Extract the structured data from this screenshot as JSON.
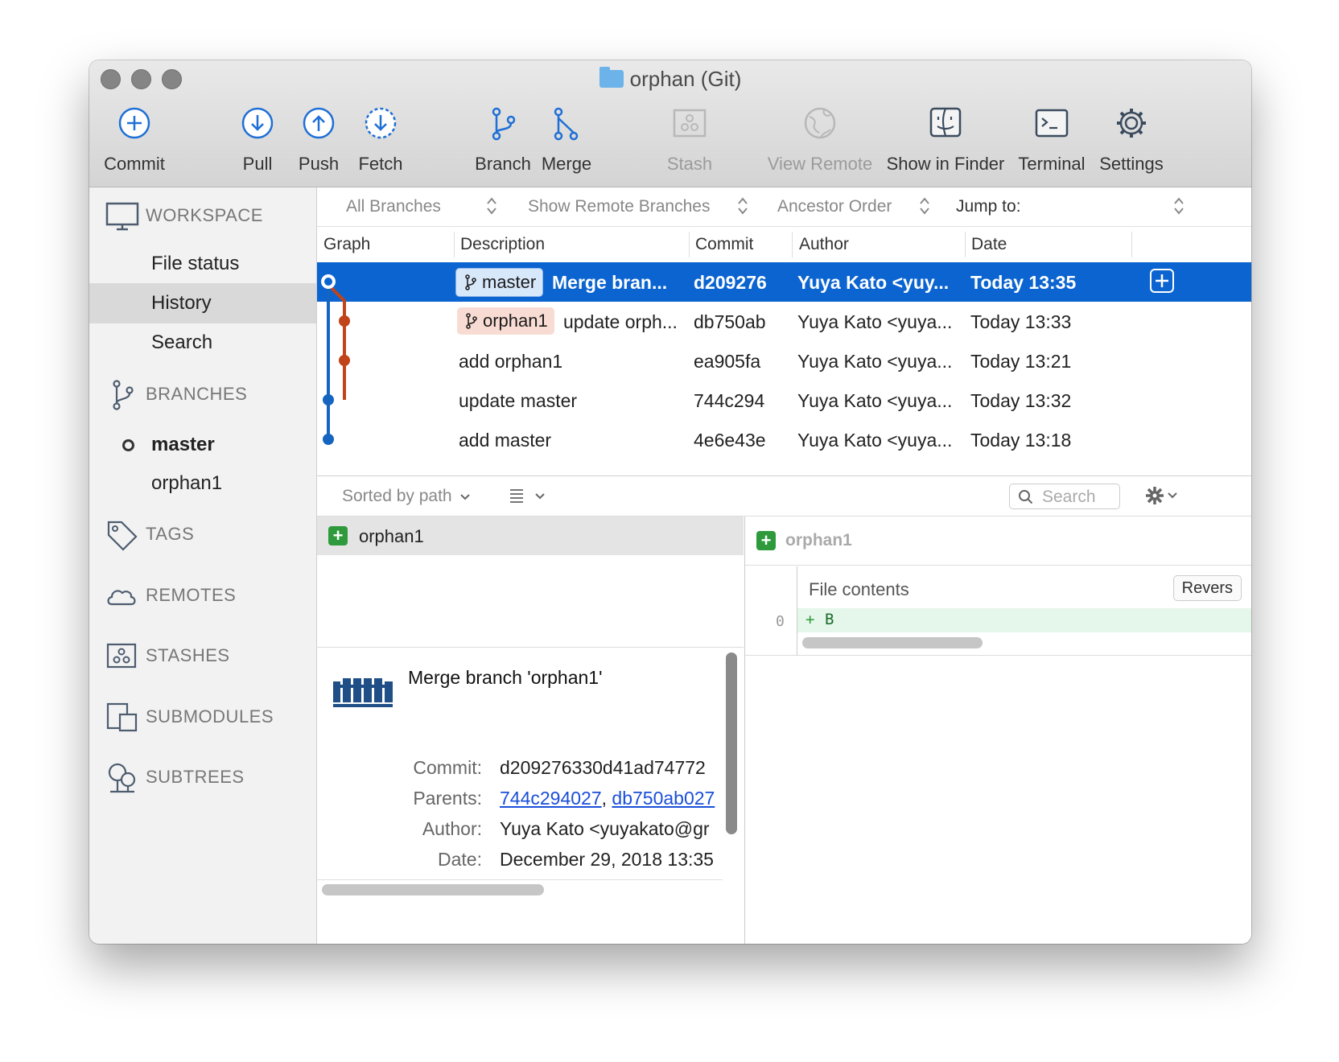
{
  "window": {
    "title": "orphan (Git)"
  },
  "toolbar": {
    "commit": "Commit",
    "pull": "Pull",
    "push": "Push",
    "fetch": "Fetch",
    "branch": "Branch",
    "merge": "Merge",
    "stash": "Stash",
    "view_remote": "View Remote",
    "show_in_finder": "Show in Finder",
    "terminal": "Terminal",
    "settings": "Settings"
  },
  "sidebar": {
    "workspace": "WORKSPACE",
    "workspace_items": [
      "File status",
      "History",
      "Search"
    ],
    "branches": "BRANCHES",
    "branch_items": [
      "master",
      "orphan1"
    ],
    "tags": "TAGS",
    "remotes": "REMOTES",
    "stashes": "STASHES",
    "submodules": "SUBMODULES",
    "subtrees": "SUBTREES"
  },
  "filters": {
    "branches": "All Branches",
    "remote": "Show Remote Branches",
    "order": "Ancestor Order",
    "jump": "Jump to:"
  },
  "columns": {
    "graph": "Graph",
    "description": "Description",
    "commit": "Commit",
    "author": "Author",
    "date": "Date"
  },
  "commits": [
    {
      "tag": "master",
      "description": "Merge bran...",
      "commit": "d209276",
      "author": "Yuya Kato <yuy...",
      "date": "Today 13:35"
    },
    {
      "tag": "orphan1",
      "description": "update orph...",
      "commit": "db750ab",
      "author": "Yuya Kato <yuya...",
      "date": "Today 13:33"
    },
    {
      "tag": "",
      "description": "add orphan1",
      "commit": "ea905fa",
      "author": "Yuya Kato <yuya...",
      "date": "Today 13:21"
    },
    {
      "tag": "",
      "description": "update master",
      "commit": "744c294",
      "author": "Yuya Kato <yuya...",
      "date": "Today 13:32"
    },
    {
      "tag": "",
      "description": "add master",
      "commit": "4e6e43e",
      "author": "Yuya Kato <yuya...",
      "date": "Today 13:18"
    }
  ],
  "file_bar": {
    "sort": "Sorted by path",
    "search_placeholder": "Search"
  },
  "files": [
    {
      "name": "orphan1",
      "status": "added"
    }
  ],
  "commit_detail": {
    "message": "Merge branch 'orphan1'",
    "commit_label": "Commit:",
    "commit_value": "d209276330d41ad74772",
    "parents_label": "Parents:",
    "parent1": "744c294027",
    "parent_sep": ",",
    "parent2": "db750ab027",
    "author_label": "Author:",
    "author_value": "Yuya Kato <yuyakato@gr",
    "date_label": "Date:",
    "date_value": "December 29, 2018 13:35"
  },
  "diff": {
    "file": "orphan1",
    "hunk_title": "File contents",
    "revert": "Revers",
    "line_no": "0",
    "line_marker": "+",
    "line_text": "B"
  },
  "colors": {
    "selection": "#0b64d0",
    "branch_master": "#1565c0",
    "branch_orphan": "#c0431a",
    "added": "#2e9a3c"
  }
}
